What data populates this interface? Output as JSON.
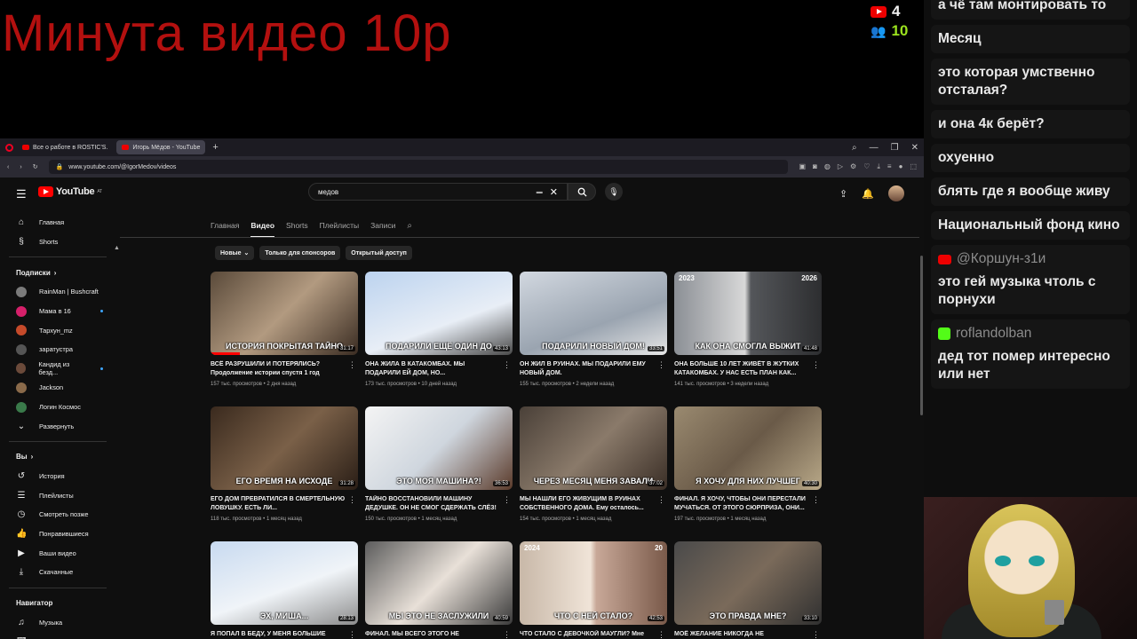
{
  "overlay": {
    "title": "Минута видео 10р",
    "youtube_viewers": "4",
    "kick_viewers": "10"
  },
  "chat": {
    "messages": [
      {
        "author": "",
        "text": "а чё там монтировать то"
      },
      {
        "author": "",
        "text": "Месяц"
      },
      {
        "author": "",
        "text": "это которая умственно отсталая?"
      },
      {
        "author": "",
        "text": "и она 4к берёт?"
      },
      {
        "author": "",
        "text": "охуенно"
      },
      {
        "author": "",
        "text": "блять где я вообще живу"
      },
      {
        "author": "",
        "text": "Национальный фонд кино"
      },
      {
        "author": "@Коршун-з1и",
        "platform": "youtube",
        "text": "это гей музыка чтоль с порнухи"
      },
      {
        "author": "roflandolban",
        "platform": "kick",
        "text": "дед тот помер интересно или нет"
      }
    ]
  },
  "browser": {
    "tabs": [
      {
        "label": "Все о работе в ROSTIC'S."
      },
      {
        "label": "Игорь Мёдов - YouTube"
      }
    ],
    "tab_add": "+",
    "url": "www.youtube.com/@IgorMedov/videos"
  },
  "youtube": {
    "logo_text": "YouTube",
    "logo_country": "AT",
    "search_value": "медов",
    "sidebar": {
      "main": [
        {
          "label": "Главная",
          "icon": "home-icon"
        },
        {
          "label": "Shorts",
          "icon": "shorts-icon"
        }
      ],
      "subs_header": "Подписки",
      "subs": [
        {
          "label": "RainMan | Bushcraft",
          "live": false
        },
        {
          "label": "Мама в 16",
          "live": true
        },
        {
          "label": "Тархун_mz",
          "live": false
        },
        {
          "label": "заратустра",
          "live": false
        },
        {
          "label": "Кандид из безд...",
          "live": true
        },
        {
          "label": "Jackson",
          "live": false
        },
        {
          "label": "Логин Космос",
          "live": false
        }
      ],
      "expand": "Развернуть",
      "you_header": "Вы",
      "you": [
        {
          "label": "История",
          "icon": "history-icon"
        },
        {
          "label": "Плейлисты",
          "icon": "playlist-icon"
        },
        {
          "label": "Смотреть позже",
          "icon": "clock-icon"
        },
        {
          "label": "Понравившиеся",
          "icon": "like-icon"
        },
        {
          "label": "Ваши видео",
          "icon": "video-icon"
        },
        {
          "label": "Скачанные",
          "icon": "download-icon"
        }
      ],
      "nav_header": "Навигатор",
      "nav": [
        {
          "label": "Музыка",
          "icon": "music-icon"
        },
        {
          "label": "Фильмы",
          "icon": "film-icon"
        }
      ]
    },
    "channel_tabs": [
      "Главная",
      "Видео",
      "Shorts",
      "Плейлисты",
      "Записи"
    ],
    "active_tab": "Видео",
    "chips": [
      "Новые",
      "Только для спонсоров",
      "Открытый доступ"
    ],
    "videos": [
      {
        "caption": "ИСТОРИЯ ПОКРЫТАЯ ТАЙНО",
        "duration": "31:17",
        "title": "ВСЁ РАЗРУШИЛИ И ПОТЕРЯЛИСЬ? Продолжение истории спустя 1 год",
        "views": "157 тыс. просмотров",
        "age": "2 дня назад",
        "years": [],
        "progress": 0.2
      },
      {
        "caption": "ПОДАРИЛИ ЕЩЁ ОДИН ДО",
        "duration": "43:13",
        "title": "ОНА ЖИЛА В КАТАКОМБАХ. МЫ ПОДАРИЛИ ЕЙ ДОМ, НО...",
        "views": "173 тыс. просмотров",
        "age": "10 дней назад",
        "years": [],
        "progress": 0
      },
      {
        "caption": "ПОДАРИЛИ НОВЫЙ ДОМ!",
        "duration": "33:51",
        "title": "ОН ЖИЛ В РУИНАХ. МЫ ПОДАРИЛИ ЕМУ НОВЫЙ ДОМ.",
        "views": "155 тыс. просмотров",
        "age": "2 недели назад",
        "years": [],
        "progress": 0
      },
      {
        "caption": "КАК ОНА СМОГЛА ВЫЖИТ",
        "duration": "41:48",
        "title": "ОНА БОЛЬШЕ 10 ЛЕТ ЖИВЁТ В ЖУТКИХ КАТАКОМБАХ. У НАС ЕСТЬ ПЛАН КАК...",
        "views": "141 тыс. просмотров",
        "age": "3 недели назад",
        "years": [
          "2023",
          "2026"
        ],
        "progress": 0
      },
      {
        "caption": "ЕГО ВРЕМЯ НА ИСХОДЕ",
        "duration": "31:28",
        "title": "ЕГО ДОМ ПРЕВРАТИЛСЯ В СМЕРТЕЛЬНУЮ ЛОВУШКУ. ЕСТЬ ЛИ...",
        "views": "118 тыс. просмотров",
        "age": "1 месяц назад",
        "years": [],
        "progress": 0
      },
      {
        "caption": "ЭТО МОЯ МАШИНА?!",
        "duration": "36:53",
        "title": "ТАЙНО ВОССТАНОВИЛИ МАШИНУ ДЕДУШКЕ. ОН НЕ СМОГ СДЕРЖАТЬ СЛЁЗ!",
        "views": "150 тыс. просмотров",
        "age": "1 месяц назад",
        "years": [],
        "progress": 0
      },
      {
        "caption": "ЧЕРЕЗ МЕСЯЦ МЕНЯ ЗАВАЛИ",
        "duration": "37:02",
        "title": "МЫ НАШЛИ ЕГО ЖИВУЩИМ В РУИНАХ СОБСТВЕННОГО ДОМА. Ему осталось...",
        "views": "154 тыс. просмотров",
        "age": "1 месяц назад",
        "years": [],
        "progress": 0
      },
      {
        "caption": "Я ХОЧУ ДЛЯ НИХ ЛУЧШЕГ",
        "duration": "40:30",
        "title": "ФИНАЛ. Я ХОЧУ, ЧТОБЫ ОНИ ПЕРЕСТАЛИ МУЧАТЬСЯ. ОТ ЭТОГО СЮРПРИЗА, ОНИ...",
        "views": "197 тыс. просмотров",
        "age": "1 месяц назад",
        "years": [],
        "progress": 0
      },
      {
        "caption": "ЭХ, МИША...",
        "duration": "28:13",
        "title": "Я ПОПАЛ В БЕДУ, У МЕНЯ БОЛЬШИЕ",
        "views": "",
        "age": "",
        "years": [],
        "progress": 0
      },
      {
        "caption": "МЫ ЭТО НЕ ЗАСЛУЖИЛИ",
        "duration": "40:59",
        "title": "ФИНАЛ. МЫ ВСЕГО ЭТОГО НЕ",
        "views": "",
        "age": "",
        "years": [],
        "progress": 0
      },
      {
        "caption": "ЧТО С НЕЙ СТАЛО?",
        "duration": "42:53",
        "title": "ЧТО СТАЛО С ДЕВОЧКОЙ МАУГЛИ? Мне",
        "views": "",
        "age": "",
        "years": [
          "2024",
          "20"
        ],
        "progress": 0
      },
      {
        "caption": "ЭТО ПРАВДА МНЕ?",
        "duration": "33:10",
        "title": "МОЁ ЖЕЛАНИЕ НИКОГДА НЕ",
        "views": "",
        "age": "",
        "years": [],
        "progress": 0
      }
    ]
  }
}
